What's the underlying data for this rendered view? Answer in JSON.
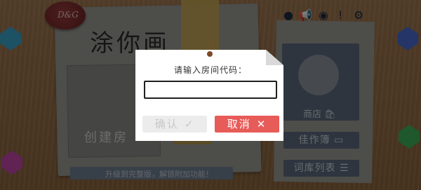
{
  "game": {
    "title": "涂你画",
    "seal_text": "D&G",
    "create_room_label": "创建房",
    "upgrade_banner": "升级到完整版，解锁附加功能！",
    "shop_label": "商店",
    "menu": [
      {
        "label": "佳作簿",
        "icon": "book-icon"
      },
      {
        "label": "词库列表",
        "icon": "list-icon"
      }
    ],
    "top_icons": [
      "user-icon",
      "megaphone-icon",
      "profile-icon",
      "notice-icon",
      "gear-icon"
    ]
  },
  "dialog": {
    "title": "请输入房间代码：",
    "input_value": "",
    "input_placeholder": "",
    "confirm_label": "确认",
    "confirm_icon": "check-icon",
    "cancel_label": "取消",
    "cancel_icon": "close-icon",
    "colors": {
      "cancel": "#e75b58",
      "confirm_disabled": "#ececec"
    }
  }
}
